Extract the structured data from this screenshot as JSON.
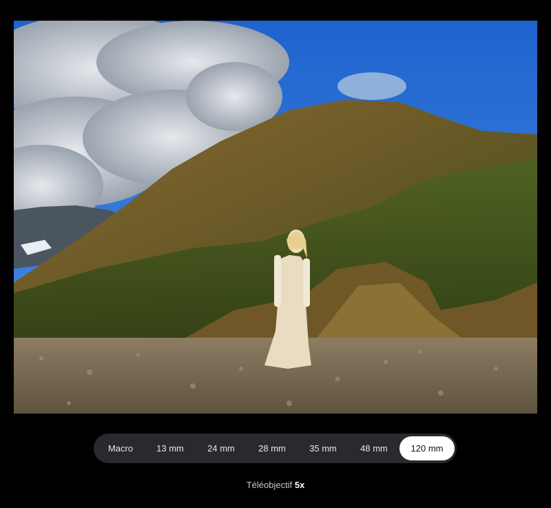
{
  "photo": {
    "description_icon": "landscape-photo"
  },
  "lens_selector": {
    "options": [
      {
        "label": "Macro"
      },
      {
        "label": "13 mm"
      },
      {
        "label": "24 mm"
      },
      {
        "label": "28 mm"
      },
      {
        "label": "35 mm"
      },
      {
        "label": "48 mm"
      },
      {
        "label": "120 mm"
      }
    ],
    "selected_label": "120 mm"
  },
  "caption": {
    "prefix": "Téléobjectif",
    "zoom": "5x"
  },
  "colors": {
    "background": "#000000",
    "pill_background": "#2a2a2e",
    "selected_background": "#ffffff"
  }
}
